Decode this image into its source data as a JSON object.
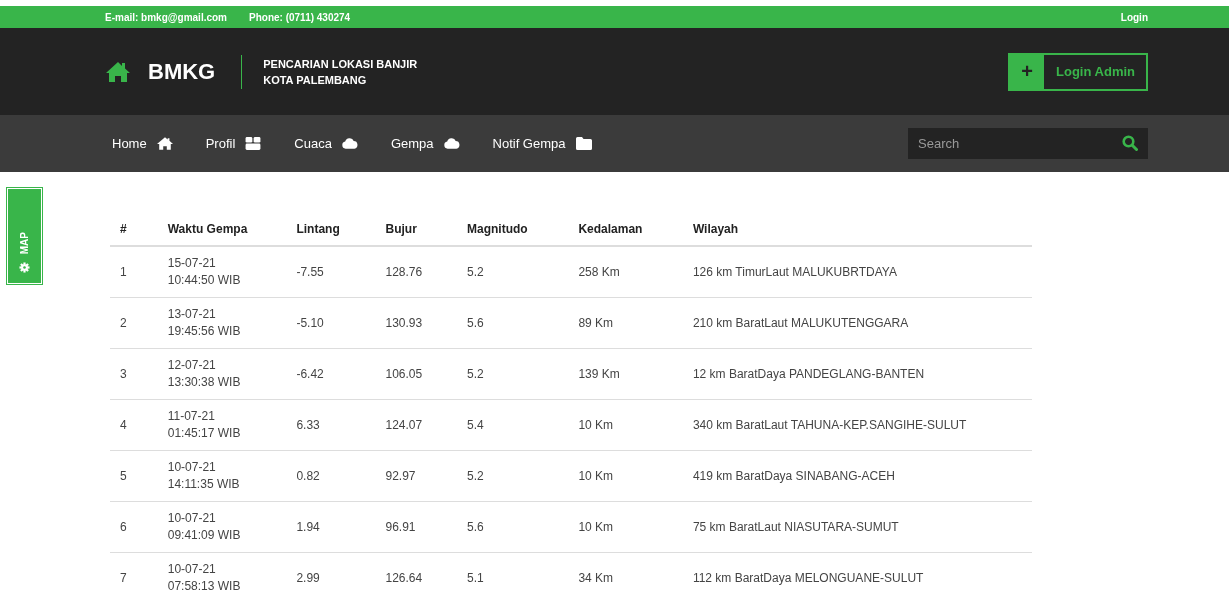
{
  "topbar": {
    "email": "E-mail: bmkg@gmail.com",
    "phone": "Phone: (0711) 430274",
    "login": "Login"
  },
  "header": {
    "brand": "BMKG",
    "subtitle_lines": [
      "PENCARIAN LOKASI BANJIR",
      "KOTA PALEMBANG"
    ],
    "button_icon": "+",
    "button_label": "Login Admin"
  },
  "nav": {
    "items": [
      {
        "label": "Home",
        "kind": "home"
      },
      {
        "label": "Profil",
        "kind": "box"
      },
      {
        "label": "Cuaca",
        "kind": "cloud"
      },
      {
        "label": "Gempa",
        "kind": "cloud"
      },
      {
        "label": "Notif Gempa",
        "kind": "folder"
      }
    ],
    "search": {
      "placeholder": "Search"
    }
  },
  "side_tab": {
    "label": "MAP"
  },
  "table": {
    "columns": [
      "#",
      "Waktu Gempa",
      "Lintang",
      "Bujur",
      "Magnitudo",
      "Kedalaman",
      "Wilayah"
    ],
    "rows": [
      [
        "1",
        [
          "15-07-21",
          "10:44:50 WIB"
        ],
        "-7.55",
        "128.76",
        "5.2",
        "258 Km",
        "126 km TimurLaut MALUKUBRTDAYA"
      ],
      [
        "2",
        [
          "13-07-21",
          "19:45:56 WIB"
        ],
        "-5.10",
        "130.93",
        "5.6",
        "89 Km",
        "210 km BaratLaut MALUKUTENGGARA"
      ],
      [
        "3",
        [
          "12-07-21",
          "13:30:38 WIB"
        ],
        "-6.42",
        "106.05",
        "5.2",
        "139 Km",
        "12 km BaratDaya PANDEGLANG-BANTEN"
      ],
      [
        "4",
        [
          "11-07-21",
          "01:45:17 WIB"
        ],
        "6.33",
        "124.07",
        "5.4",
        "10 Km",
        "340 km BaratLaut TAHUNA-KEP.SANGIHE-SULUT"
      ],
      [
        "5",
        [
          "10-07-21",
          "14:11:35 WIB"
        ],
        "0.82",
        "92.97",
        "5.2",
        "10 Km",
        "419 km BaratDaya SINABANG-ACEH"
      ],
      [
        "6",
        [
          "10-07-21",
          "09:41:09 WIB"
        ],
        "1.94",
        "96.91",
        "5.6",
        "10 Km",
        "75 km BaratLaut NIASUTARA-SUMUT"
      ],
      [
        "7",
        [
          "10-07-21",
          "07:58:13 WIB"
        ],
        "2.99",
        "126.64",
        "5.1",
        "34 Km",
        "112 km BaratDaya MELONGUANE-SULUT"
      ]
    ]
  }
}
